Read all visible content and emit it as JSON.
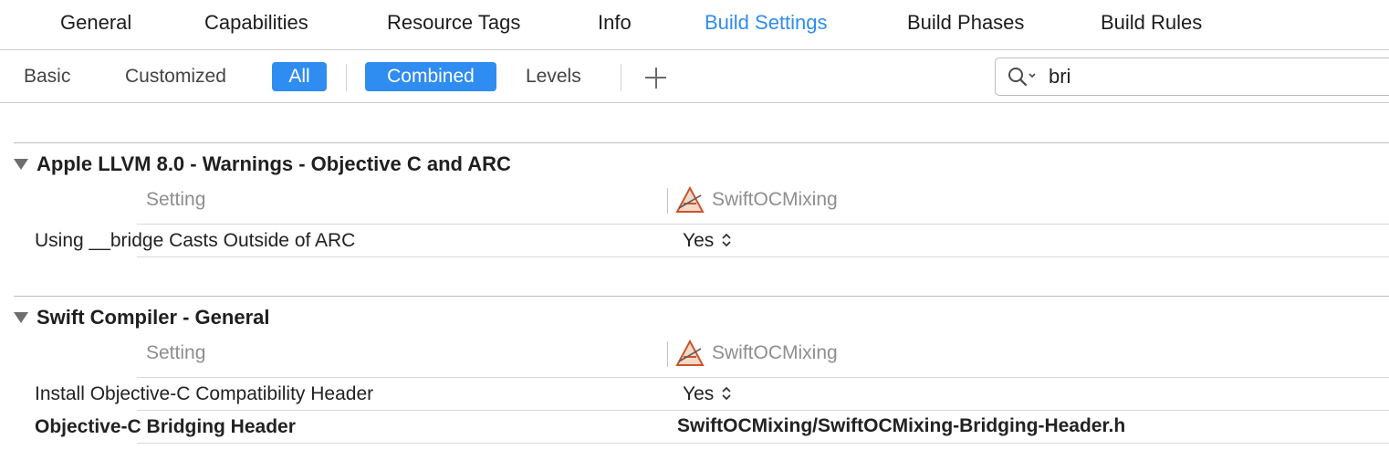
{
  "tabs": [
    {
      "label": "General",
      "active": false
    },
    {
      "label": "Capabilities",
      "active": false
    },
    {
      "label": "Resource Tags",
      "active": false
    },
    {
      "label": "Info",
      "active": false
    },
    {
      "label": "Build Settings",
      "active": true
    },
    {
      "label": "Build Phases",
      "active": false
    },
    {
      "label": "Build Rules",
      "active": false
    }
  ],
  "filters": {
    "basic": "Basic",
    "customized": "Customized",
    "all": "All",
    "combined": "Combined",
    "levels": "Levels",
    "selected_scope": "All",
    "selected_view": "Combined"
  },
  "search": {
    "value": "bri",
    "icon": "search-icon"
  },
  "sections": [
    {
      "title": "Apple LLVM 8.0 - Warnings - Objective C and ARC",
      "col_setting": "Setting",
      "col_target": "SwiftOCMixing",
      "rows": [
        {
          "name": "Using __bridge Casts Outside of ARC",
          "value": "Yes",
          "bold": false,
          "stepper": true
        }
      ]
    },
    {
      "title": "Swift Compiler - General",
      "col_setting": "Setting",
      "col_target": "SwiftOCMixing",
      "rows": [
        {
          "name": "Install Objective-C Compatibility Header",
          "value": "Yes",
          "bold": false,
          "stepper": true
        },
        {
          "name": "Objective-C Bridging Header",
          "value": "SwiftOCMixing/SwiftOCMixing-Bridging-Header.h",
          "bold": true,
          "stepper": false
        }
      ]
    }
  ],
  "colors": {
    "accent": "#2f8cf0",
    "separator": "#d9d9d9",
    "muted_text": "#8e8e8e"
  }
}
